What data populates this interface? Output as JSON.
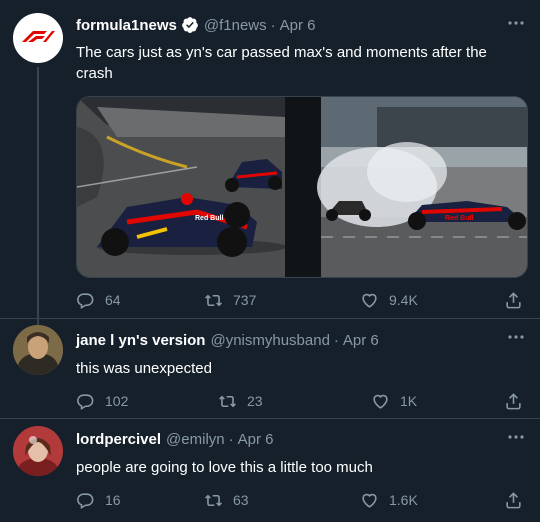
{
  "tweets": [
    {
      "name": "formula1news",
      "handle": "@f1news",
      "time": "Apr 6",
      "text": "The cars just as yn's car passed max's and moments after the crash",
      "replies": "64",
      "retweets": "737",
      "likes": "9.4K",
      "avatar_logo": "F1"
    },
    {
      "name": "jane l yn's version",
      "handle": "@ynismyhusband",
      "time": "Apr 6",
      "text": "this was unexpected",
      "replies": "102",
      "retweets": "23",
      "likes": "1K"
    },
    {
      "name": "lordpercivel",
      "handle": "@emilyn",
      "time": "Apr 6",
      "text": "people are going to love this a little too much",
      "replies": "16",
      "retweets": "63",
      "likes": "1.6K"
    }
  ],
  "media": {
    "left_sign": "Red Bull",
    "right_sign": "Red Bull"
  },
  "icons": {
    "reply": "reply-icon",
    "retweet": "retweet-icon",
    "like": "heart-icon",
    "share": "share-icon",
    "more": "more-icon",
    "verified": "verified-badge-icon"
  },
  "colors": {
    "background": "#15202b",
    "secondary_text": "#8899a6",
    "border": "#38444d",
    "f1_red": "#e10600",
    "verified": "#ffffff"
  }
}
